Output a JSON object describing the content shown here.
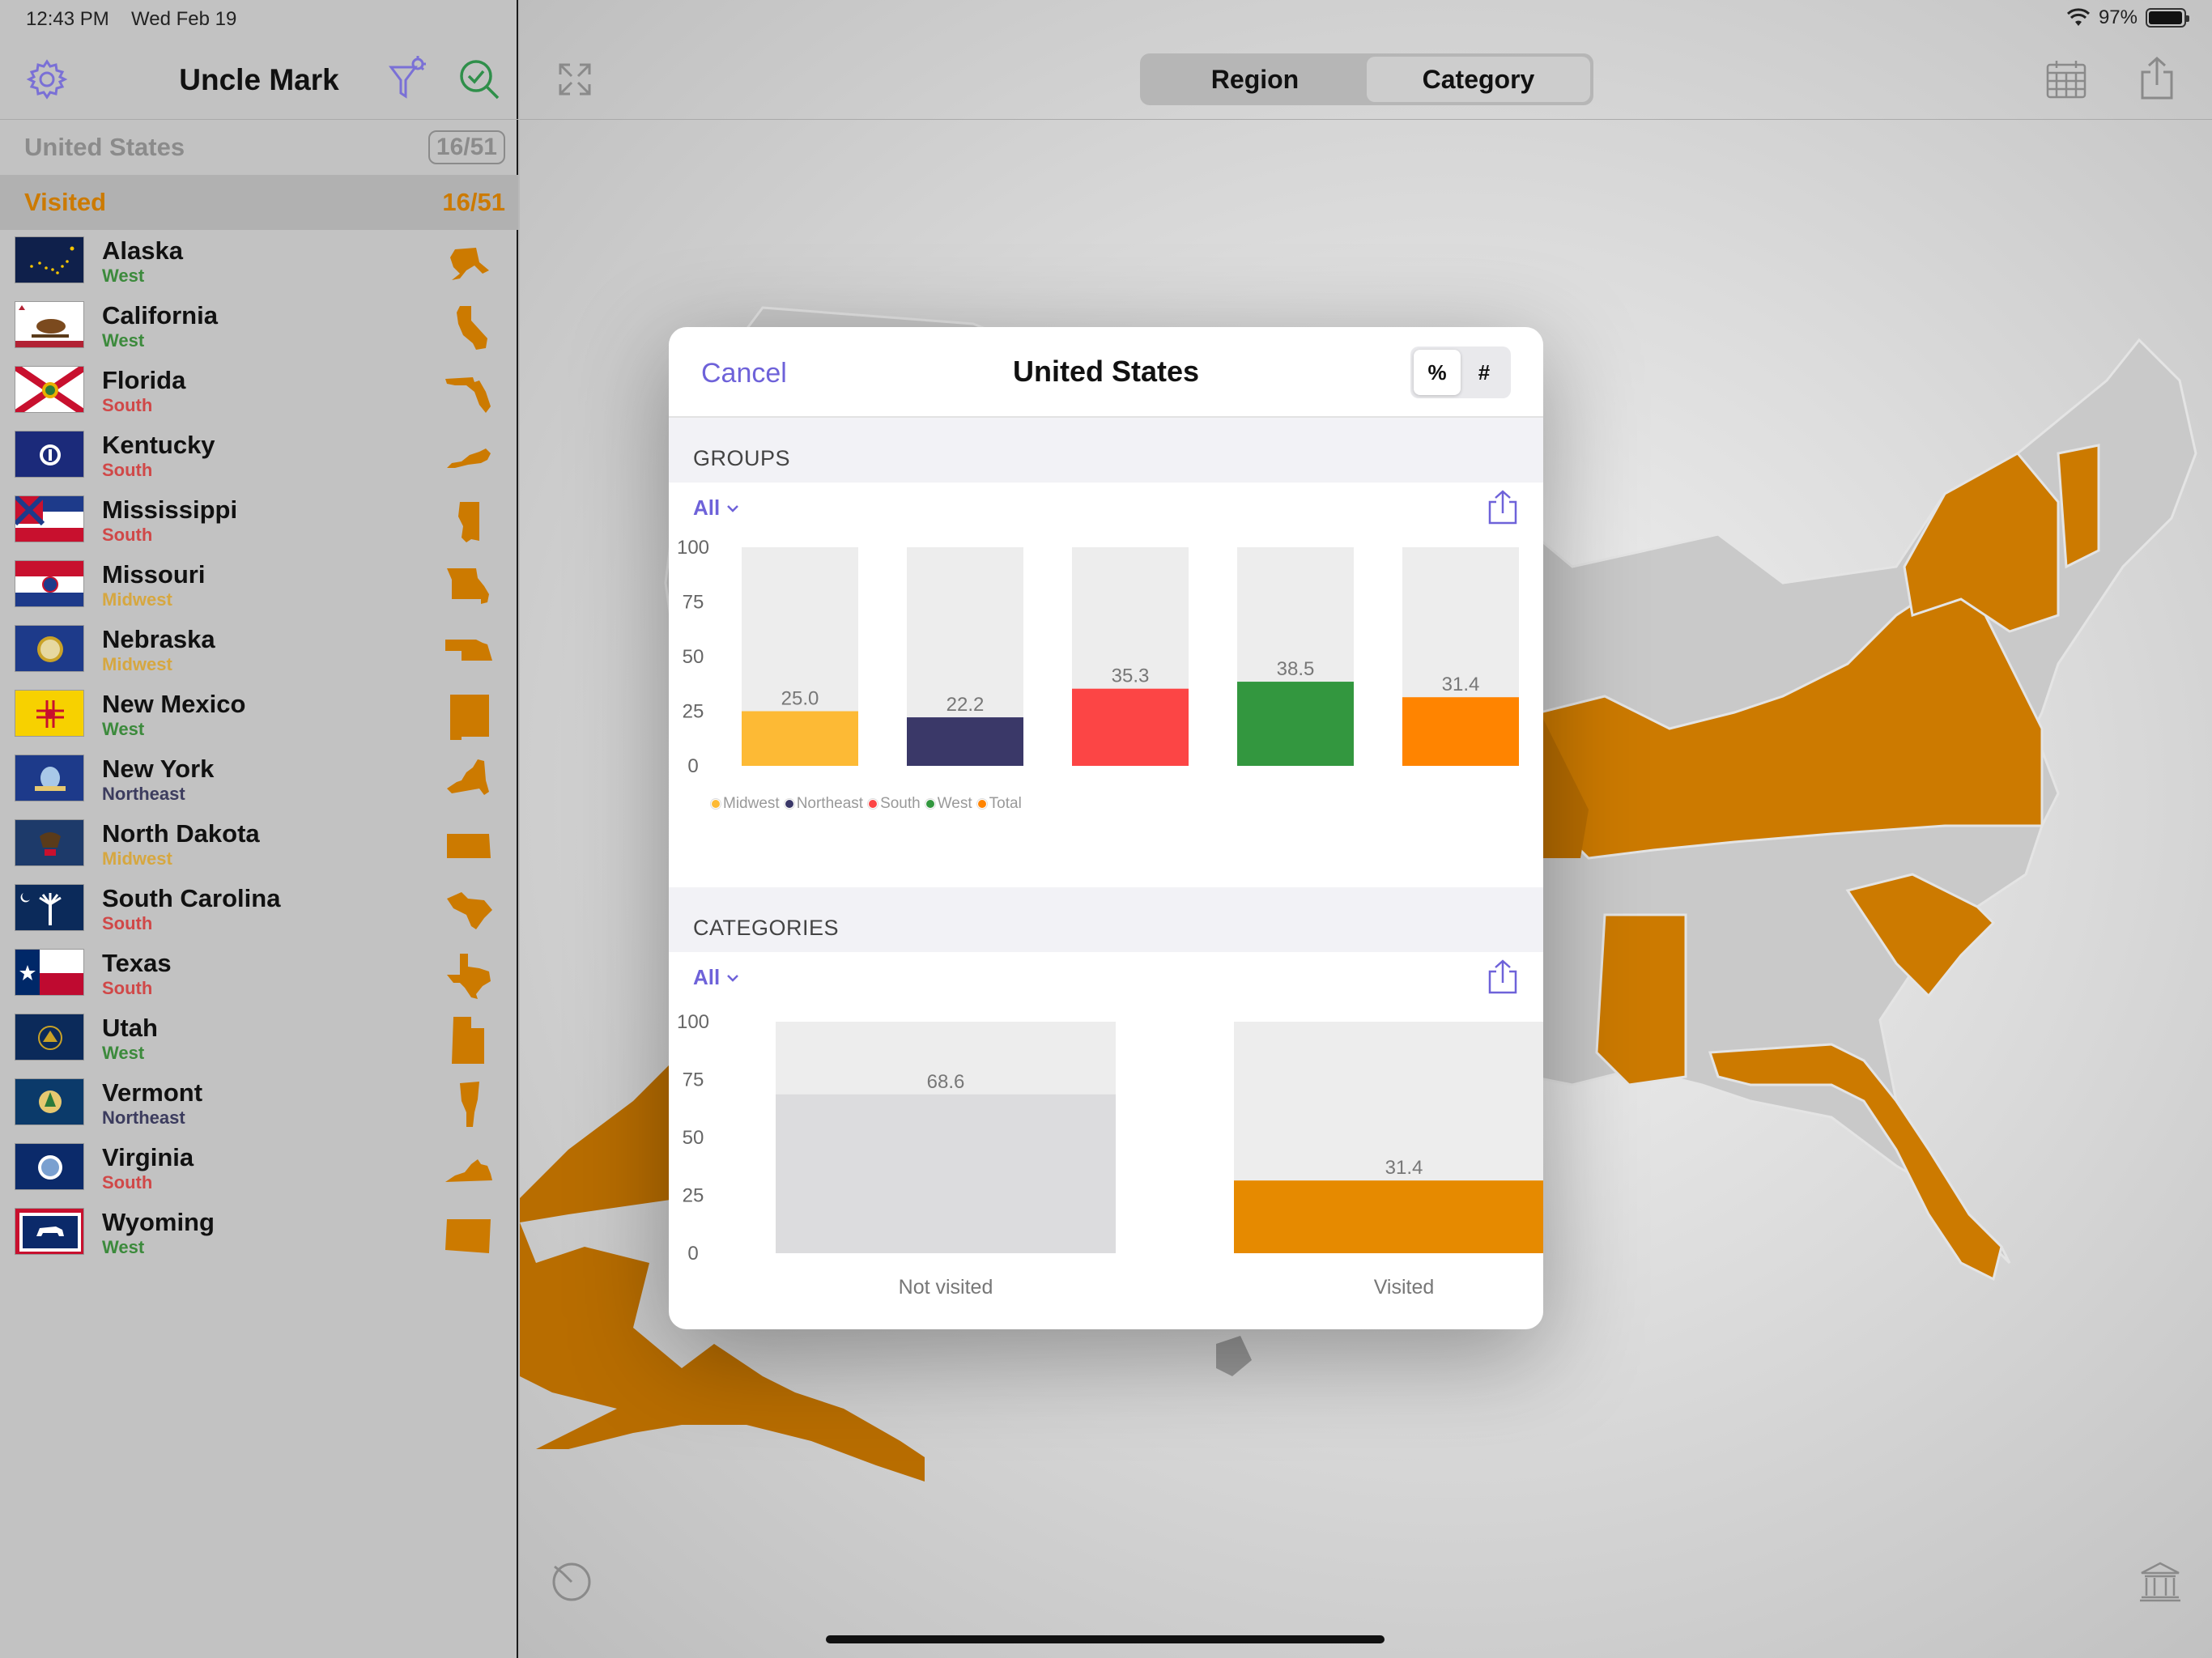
{
  "status": {
    "time": "12:43 PM",
    "date": "Wed Feb 19",
    "battery": "97%"
  },
  "sidebar": {
    "title": "Uncle Mark",
    "section_country": {
      "label": "United States",
      "count": "16/51"
    },
    "section_visited": {
      "label": "Visited",
      "count": "16/51"
    },
    "states": [
      {
        "name": "Alaska",
        "region": "West"
      },
      {
        "name": "California",
        "region": "West"
      },
      {
        "name": "Florida",
        "region": "South"
      },
      {
        "name": "Kentucky",
        "region": "South"
      },
      {
        "name": "Mississippi",
        "region": "South"
      },
      {
        "name": "Missouri",
        "region": "Midwest"
      },
      {
        "name": "Nebraska",
        "region": "Midwest"
      },
      {
        "name": "New Mexico",
        "region": "West"
      },
      {
        "name": "New York",
        "region": "Northeast"
      },
      {
        "name": "North Dakota",
        "region": "Midwest"
      },
      {
        "name": "South Carolina",
        "region": "South"
      },
      {
        "name": "Texas",
        "region": "South"
      },
      {
        "name": "Utah",
        "region": "West"
      },
      {
        "name": "Vermont",
        "region": "Northeast"
      },
      {
        "name": "Virginia",
        "region": "South"
      },
      {
        "name": "Wyoming",
        "region": "West"
      }
    ]
  },
  "main": {
    "segments": [
      "Region",
      "Category"
    ],
    "active_segment": "Category"
  },
  "colors": {
    "visited": "#cc7a00",
    "accent": "#6e62d9",
    "midwest": "#fdba35",
    "northeast": "#3a3868",
    "south": "#fc4545",
    "west": "#33973f",
    "total": "#ff8400",
    "not_visited": "#dcdcde",
    "track": "#ededed"
  },
  "modal": {
    "cancel": "Cancel",
    "title": "United States",
    "mode_options": [
      "%",
      "#"
    ],
    "active_mode": "%",
    "groups_header": "GROUPS",
    "categories_header": "CATEGORIES",
    "filter_label": "All"
  },
  "chart_data": [
    {
      "type": "bar",
      "categories": [
        "Midwest",
        "Northeast",
        "South",
        "West",
        "Total"
      ],
      "values": [
        25.0,
        22.2,
        35.3,
        38.5,
        31.4
      ],
      "value_labels": [
        "25.0",
        "22.2",
        "35.3",
        "38.5",
        "31.4"
      ],
      "colors": [
        "#fdba35",
        "#3a3868",
        "#fc4545",
        "#33973f",
        "#ff8400"
      ],
      "yticks": [
        "0",
        "25",
        "50",
        "75",
        "100"
      ],
      "ylim": [
        0,
        100
      ],
      "legend": [
        "Midwest",
        "Northeast",
        "South",
        "West",
        "Total"
      ],
      "legend_placement": "bottom-left"
    },
    {
      "type": "bar",
      "categories": [
        "Not visited",
        "Visited"
      ],
      "values": [
        68.6,
        31.4
      ],
      "value_labels": [
        "68.6",
        "31.4"
      ],
      "colors": [
        "#dcdcde",
        "#e68a00"
      ],
      "yticks": [
        "0",
        "25",
        "50",
        "75",
        "100"
      ],
      "ylim": [
        0,
        100
      ]
    }
  ]
}
